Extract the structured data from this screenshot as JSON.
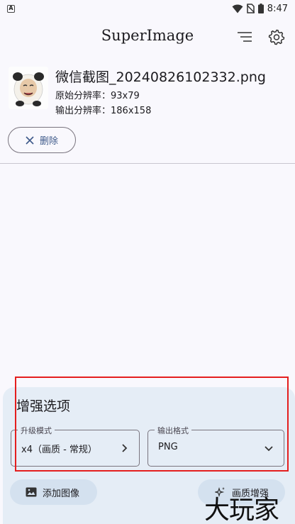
{
  "status_bar": {
    "notif_letter": "A",
    "time": "8:47"
  },
  "app_bar": {
    "title": "SuperImage",
    "menu_icon": "sort-lines-icon",
    "settings_icon": "gear-icon"
  },
  "image_info": {
    "file_name": "微信截图_20240826102332.png",
    "original_label": "原始分辨率：",
    "original_value": "93x79",
    "output_label": "输出分辨率：",
    "output_value": "186x158"
  },
  "delete_button": {
    "label": "删除"
  },
  "options": {
    "title": "增强选项",
    "upscale_mode": {
      "label": "升级模式",
      "value": "x4（画质 - 常规）"
    },
    "output_format": {
      "label": "输出格式",
      "value": "PNG"
    },
    "add_image_label": "添加图像",
    "enhance_label": "画质增强"
  },
  "watermark": "大玩家",
  "colors": {
    "accent": "#3e5a8a",
    "panel_bg": "#e5edf6",
    "button_bg": "#d4e1ef",
    "highlight": "#e41e1e"
  }
}
